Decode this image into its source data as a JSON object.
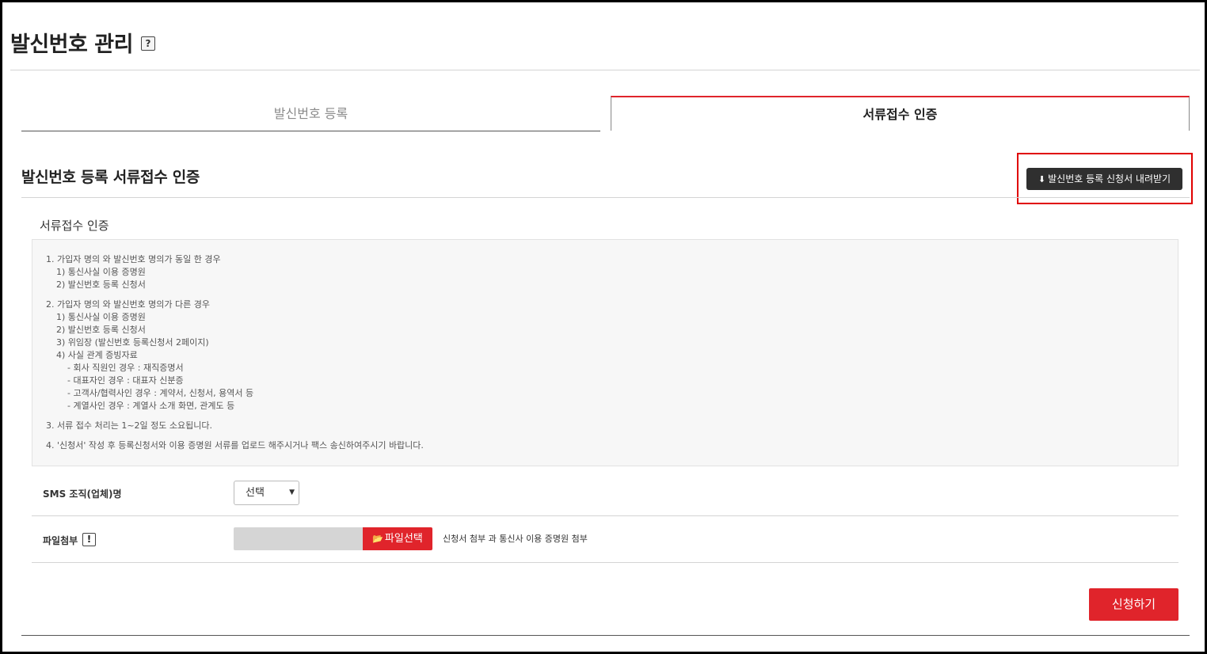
{
  "page": {
    "title": "발신번호 관리",
    "help_glyph": "?"
  },
  "tabs": [
    {
      "label": "발신번호 등록",
      "active": false
    },
    {
      "label": "서류접수 인증",
      "active": true
    }
  ],
  "section": {
    "title": "발신번호 등록 서류접수 인증",
    "download_icon": "download-icon",
    "download_label": "발신번호 등록 신청서 내려받기"
  },
  "info": {
    "subtitle": "서류접수 인증",
    "lines": [
      "1. 가입자 명의 와 발신번호 명의가 동일 한 경우",
      "1) 통신사실 이용 증명원",
      "2) 발신번호 등록 신청서",
      "2. 가입자 명의 와 발신번호 명의가 다른 경우",
      "1) 통신사실 이용 증명원",
      "2) 발신번호 등록 신청서",
      "3) 위임장 (발신번호 등록신청서 2페이지)",
      "4) 사실 관계 증빙자료",
      "- 회사 직원인 경우 : 재직증명서",
      "- 대표자인 경우 : 대표자 신분증",
      "- 고객사/협력사인 경우 : 계약서, 신청서, 용역서 등",
      "- 계열사인 경우 : 계열사 소개 화면, 관계도 등",
      "3. 서류 접수 처리는 1~2일 정도 소요됩니다.",
      "4. '신청서' 작성 후 등록신청서와 이용 증명원 서류를 업로드 해주시거나 팩스 송신하여주시기 바랍니다."
    ]
  },
  "form": {
    "org_label": "SMS 조직(업체)명",
    "org_select_value": "선택",
    "file_label": "파일첨부",
    "file_warn_glyph": "!",
    "file_button_label": "파일선택",
    "file_hint": "신청서 첨부 과 통신사 이용 증명원 첨부"
  },
  "submit_label": "신청하기",
  "colors": {
    "accent": "#e0242b",
    "dark_button": "#2f2f2f",
    "highlight_outline": "#e00000"
  }
}
